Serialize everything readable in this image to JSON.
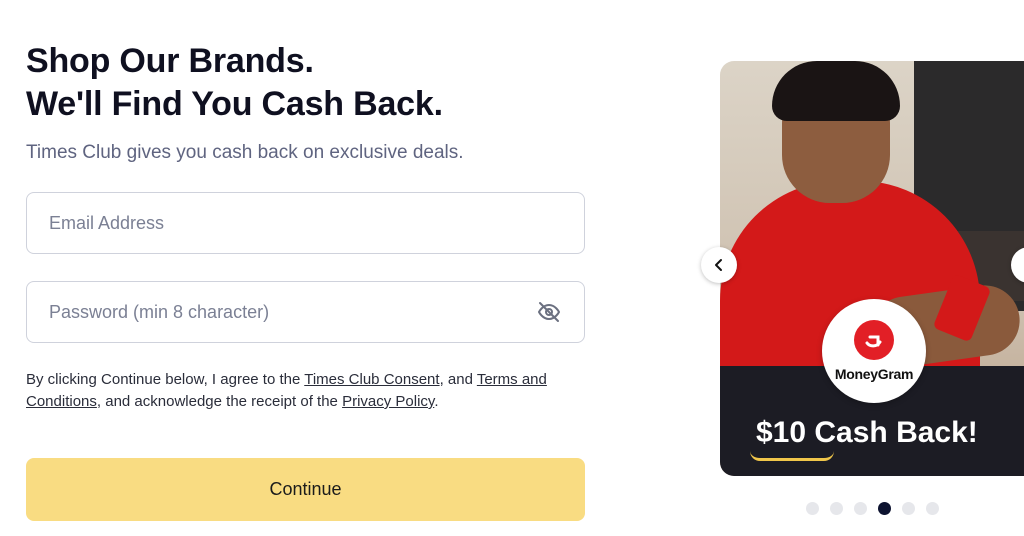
{
  "header": {
    "headline_line1": "Shop Our Brands.",
    "headline_line2": "We'll Find You Cash Back.",
    "subtitle": "Times Club gives you cash back on exclusive deals."
  },
  "form": {
    "email_placeholder": "Email Address",
    "email_value": "",
    "password_placeholder": "Password (min 8 character)",
    "password_value": "",
    "password_toggle_icon": "eye-off-icon"
  },
  "consent": {
    "prefix": "By clicking Continue below, I agree to the ",
    "consent_link": "Times Club Consent",
    "middle": ", and ",
    "terms_link": "Terms and Conditions",
    "after_terms": ", and acknowledge the receipt of the ",
    "privacy_link": "Privacy Policy",
    "suffix": "."
  },
  "continue_label": "Continue",
  "carousel": {
    "slide": {
      "brand": "MoneyGram",
      "offer": "$10 Cash Back!"
    },
    "prev_icon": "chevron-left-icon",
    "next_icon": "chevron-right-icon",
    "dot_count": 6,
    "active_index": 3
  },
  "colors": {
    "button_bg": "#f9dc82",
    "headline": "#0f1020",
    "subtitle": "#5f6480",
    "active_dot": "#0d1330",
    "brand_red": "#e21f26"
  }
}
